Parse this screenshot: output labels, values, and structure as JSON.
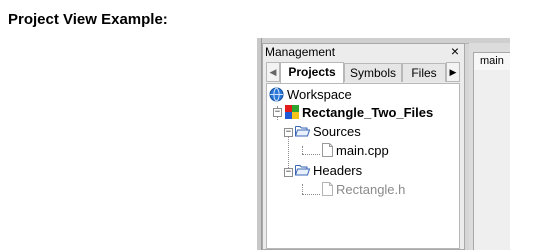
{
  "caption": "Project View Example:",
  "panel": {
    "title": "Management",
    "close": "×",
    "tabs": [
      "Projects",
      "Symbols",
      "Files"
    ],
    "tab_left_arrow": "◀",
    "tab_right_arrow": "▶"
  },
  "tree": {
    "workspace": "Workspace",
    "project": "Rectangle_Two_Files",
    "sources": "Sources",
    "source_file": "main.cpp",
    "headers": "Headers",
    "header_file": "Rectangle.h"
  },
  "editor": {
    "tab": "main"
  },
  "icons": {
    "workspace": "workspace-globe-icon",
    "project": "project-icon",
    "folder": "folder-open-icon",
    "file": "file-icon"
  }
}
